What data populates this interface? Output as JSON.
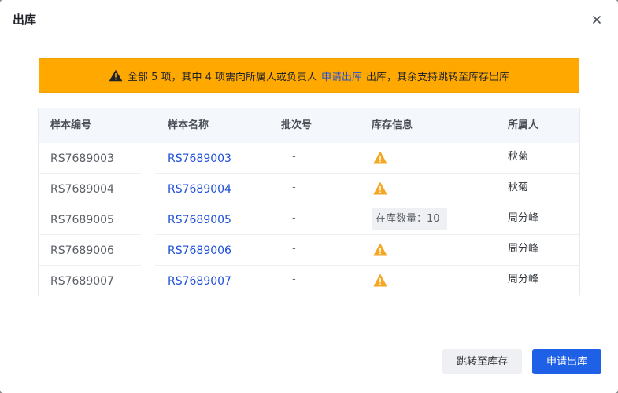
{
  "dialog": {
    "title": "出库",
    "close_icon": "close-icon"
  },
  "banner": {
    "icon": "warning-triangle-icon",
    "text_before": "全部 5 项，其中 4 项需向所属人或负责人",
    "link_text": "申请出库",
    "text_after": "出库，其余支持跳转至库存出库",
    "bg_color": "#ffa800",
    "link_color": "#1e4fd8"
  },
  "table": {
    "headers": [
      "样本编号",
      "样本名称",
      "批次号",
      "库存信息",
      "所属人"
    ],
    "rows": [
      {
        "id": "RS7689003",
        "name": "RS7689003",
        "batch": "-",
        "stock": "warning-icon",
        "stock_text": "",
        "owner": "秋菊"
      },
      {
        "id": "RS7689004",
        "name": "RS7689004",
        "batch": "-",
        "stock": "warning-icon",
        "stock_text": "",
        "owner": "秋菊"
      },
      {
        "id": "RS7689005",
        "name": "RS7689005",
        "batch": "-",
        "stock": "tag",
        "stock_text": "在库数量：10",
        "owner": "周分峰"
      },
      {
        "id": "RS7689006",
        "name": "RS7689006",
        "batch": "-",
        "stock": "warning-icon",
        "stock_text": "",
        "owner": "周分峰"
      },
      {
        "id": "RS7689007",
        "name": "RS7689007",
        "batch": "-",
        "stock": "warning-icon",
        "stock_text": "",
        "owner": "周分峰"
      }
    ]
  },
  "footer": {
    "jump_label": "跳转至库存",
    "apply_label": "申请出库"
  },
  "colors": {
    "primary": "#1e60e6",
    "warning": "#f5a623"
  }
}
